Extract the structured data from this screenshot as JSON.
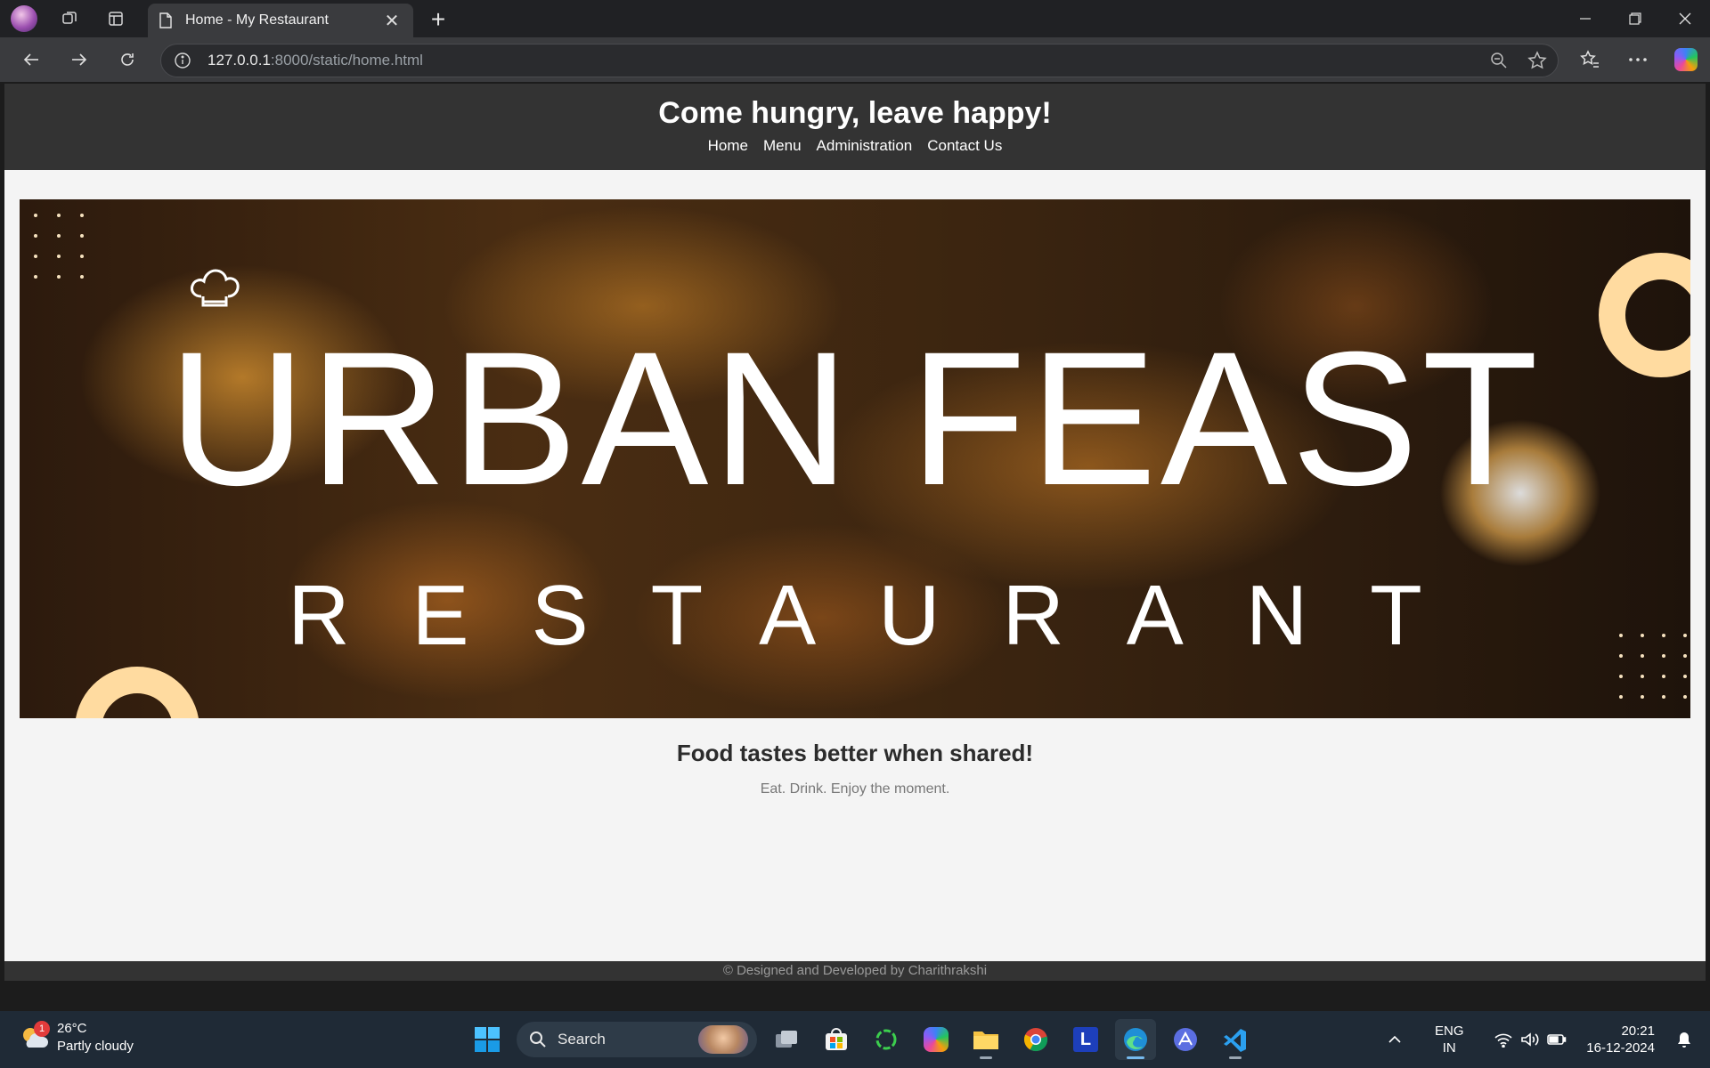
{
  "browser": {
    "tab_title": "Home - My Restaurant",
    "url_host": "127.0.0.1",
    "url_rest": ":8000/static/home.html"
  },
  "site": {
    "header_title": "Come hungry, leave happy!",
    "nav": [
      {
        "label": "Home"
      },
      {
        "label": "Menu"
      },
      {
        "label": "Administration"
      },
      {
        "label": "Contact Us"
      }
    ],
    "banner_title": "URBAN FEAST",
    "banner_subtitle": "RESTAURANT",
    "tagline": "Food tastes better when shared!",
    "subline": "Eat. Drink. Enjoy the moment.",
    "footer": "© Designed and Developed by Charithrakshi"
  },
  "taskbar": {
    "weather_temp": "26°C",
    "weather_desc": "Partly cloudy",
    "weather_badge": "1",
    "search_label": "Search",
    "lang_line1": "ENG",
    "lang_line2": "IN",
    "time": "20:21",
    "date": "16-12-2024"
  },
  "colors": {
    "header_bg": "#333333",
    "page_bg": "#f4f4f4",
    "accent_ring": "#ffdba0"
  }
}
